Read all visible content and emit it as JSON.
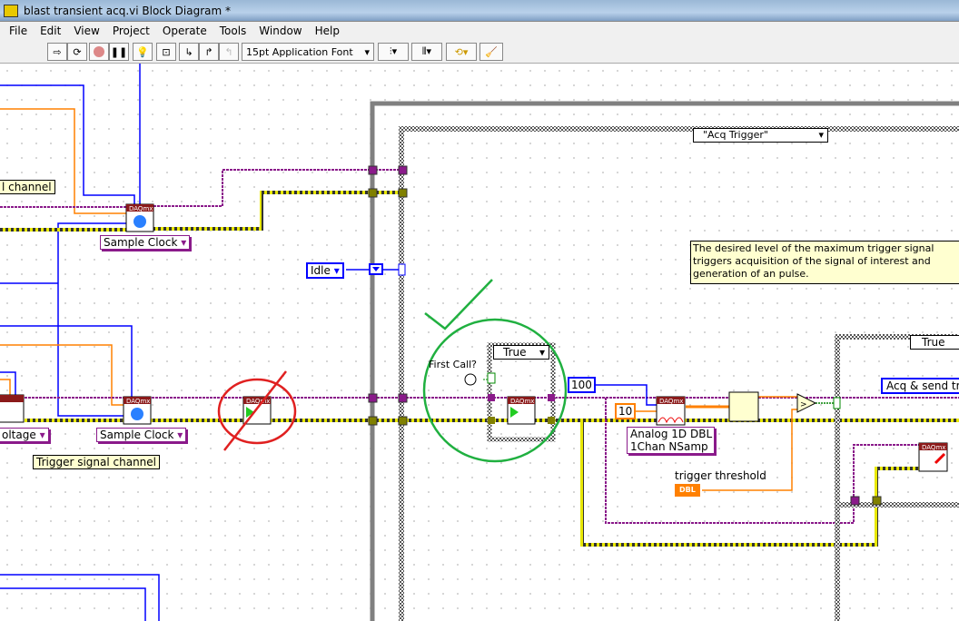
{
  "window": {
    "title": "blast transient acq.vi Block Diagram *"
  },
  "menu": [
    "File",
    "Edit",
    "View",
    "Project",
    "Operate",
    "Tools",
    "Window",
    "Help"
  ],
  "toolbar": {
    "font": "15pt Application Font",
    "buttons": [
      "run-arrow-icon",
      "run-continuously-icon",
      "abort-icon",
      "pause-icon",
      "highlight-execution-icon",
      "retain-wire-values-icon",
      "step-into-icon",
      "step-over-icon",
      "step-out-icon",
      "align-icon",
      "distribute-icon",
      "reorder-icon",
      "cleanup-icon"
    ]
  },
  "diagram": {
    "labels": {
      "channel_partial": "l channel",
      "trigger_channel": "Trigger signal channel",
      "sample_clock_1": "Sample Clock",
      "sample_clock_2": "Sample Clock",
      "voltage_partial": "oltage",
      "idle": "Idle",
      "case_selector": "\"Acq Trigger\"",
      "inner_case": "True",
      "first_call": "First Call?",
      "const_100": "100",
      "const_10": "10",
      "read_type_1": "Analog 1D DBL",
      "read_type_2": "1Chan NSamp",
      "trigger_threshold": "trigger threshold",
      "dbl": "DBL",
      "right_case": "True",
      "acq_send": "Acq & send tr",
      "comment": "The desired level of the maximum trigger signal triggers acquisition of the signal of interest and generation of an pulse.",
      "daqmx": "DAQmx",
      "question": "?"
    },
    "colors": {
      "task_wire": "#8a1a8a",
      "error_wire": "#c8c800",
      "numeric_wire": "#ff8000",
      "enum_wire": "#0000ff",
      "bool_wire": "#008000",
      "annotation_red": "#e02020",
      "annotation_green": "#20b040"
    }
  }
}
